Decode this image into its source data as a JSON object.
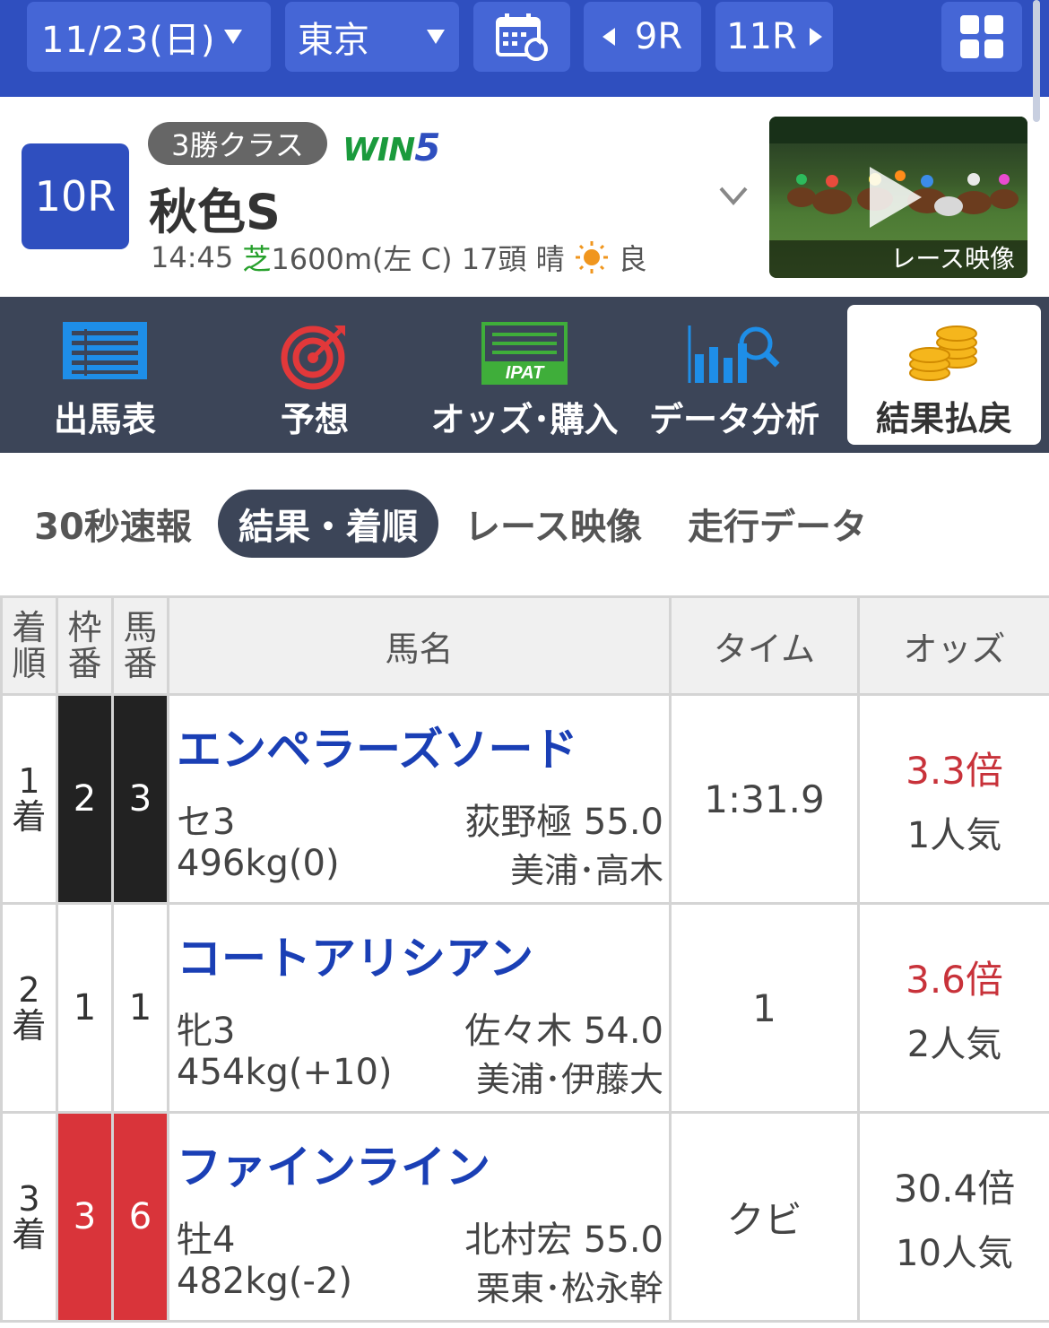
{
  "topbar": {
    "date": "11/23(日)",
    "location": "東京",
    "prev_race": "9R",
    "next_race": "11R"
  },
  "race": {
    "number": "10R",
    "class": "3勝クラス",
    "win5_text": "WIN",
    "win5_num": "5",
    "name": "秋色S",
    "time": "14:45",
    "surface": "芝",
    "distance": "1600m(左 C)",
    "runners": "17頭",
    "weather": "晴",
    "going": "良",
    "video_label": "レース映像"
  },
  "nav": {
    "items": [
      "出馬表",
      "予想",
      "オッズ･購入",
      "データ分析",
      "結果払戻"
    ]
  },
  "subtabs": [
    "30秒速報",
    "結果・着順",
    "レース映像",
    "走行データ"
  ],
  "table": {
    "headers": {
      "rank_1": "着",
      "rank_2": "順",
      "waku_1": "枠",
      "waku_2": "番",
      "umaban_1": "馬",
      "umaban_2": "番",
      "name": "馬名",
      "time": "タイム",
      "odds": "オッズ"
    },
    "rows": [
      {
        "rank_n": "1",
        "rank_s": "着",
        "waku": "2",
        "umaban": "3",
        "name": "エンペラーズソード",
        "sex_age": "セ3",
        "jockey": "荻野極 55.0",
        "weight": "496kg(0)",
        "trainer": "美浦･高木",
        "time": "1:31.9",
        "odds": "3.3倍",
        "popularity": "1人気"
      },
      {
        "rank_n": "2",
        "rank_s": "着",
        "waku": "1",
        "umaban": "1",
        "name": "コートアリシアン",
        "sex_age": "牝3",
        "jockey": "佐々木 54.0",
        "weight": "454kg(+10)",
        "trainer": "美浦･伊藤大",
        "time": "1",
        "odds": "3.6倍",
        "popularity": "2人気"
      },
      {
        "rank_n": "3",
        "rank_s": "着",
        "waku": "3",
        "umaban": "6",
        "name": "ファインライン",
        "sex_age": "牡4",
        "jockey": "北村宏 55.0",
        "weight": "482kg(-2)",
        "trainer": "栗東･松永幹",
        "time": "クビ",
        "odds": "30.4倍",
        "popularity": "10人気"
      }
    ]
  },
  "colors": {
    "topbar": "#2f4fbf",
    "nav_bg": "#3c4558",
    "horse_name": "#1a3fb5",
    "favorite_odds": "#c8323a",
    "waku_black": "#222222",
    "waku_red": "#d9343a"
  }
}
